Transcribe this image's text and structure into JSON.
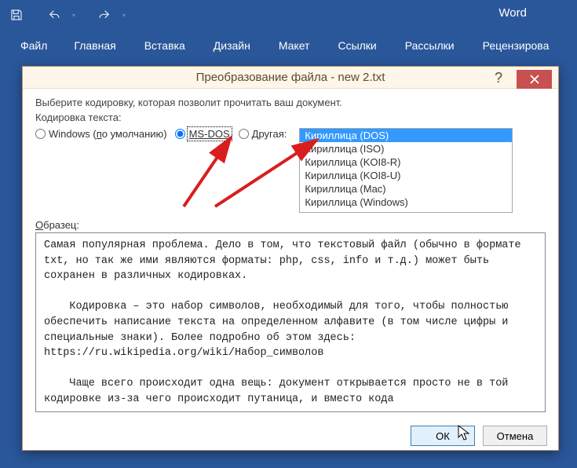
{
  "app": {
    "title": "Word"
  },
  "qat": {
    "save": "save",
    "undo": "undo",
    "redo": "redo"
  },
  "ribbon": {
    "file": "Файл",
    "tabs": [
      "Главная",
      "Вставка",
      "Дизайн",
      "Макет",
      "Ссылки",
      "Рассылки",
      "Рецензирова"
    ]
  },
  "dialog": {
    "title": "Преобразование файла - new 2.txt",
    "instruction": "Выберите кодировку, которая позволит прочитать ваш документ.",
    "group_label": "Кодировка текста:",
    "radios": {
      "windows_prefix": "Windows (",
      "windows_u": "п",
      "windows_rest": "о умолчанию)",
      "msdos": "MS-DOS",
      "other_u": "Д",
      "other_rest": "ругая:"
    },
    "selected_radio": "msdos",
    "encodings": [
      "Кириллица (DOS)",
      "Кириллица (ISO)",
      "Кириллица (KOI8-R)",
      "Кириллица (KOI8-U)",
      "Кириллица (Mac)",
      "Кириллица (Windows)"
    ],
    "selected_encoding_index": 0,
    "sample_label_u": "О",
    "sample_label_rest": "бразец:",
    "sample_text": "Самая популярная проблема. Дело в том, что текстовый файл (обычно в формате txt, но так же ими являются форматы: php, css, info и т.д.) может быть сохранен в различных кодировках.\n\n    Кодировка – это набор символов, необходимый для того, чтобы полностью обеспечить написание текста на определенном алфавите (в том числе цифры и специальные знаки). Более подробно об этом здесь: https://ru.wikipedia.org/wiki/Набор_символов\n\n    Чаще всего происходит одна вещь: документ открывается просто не в той кодировке из-за чего происходит путаница, и вместо кода",
    "buttons": {
      "ok": "ОК",
      "cancel": "Отмена"
    }
  }
}
